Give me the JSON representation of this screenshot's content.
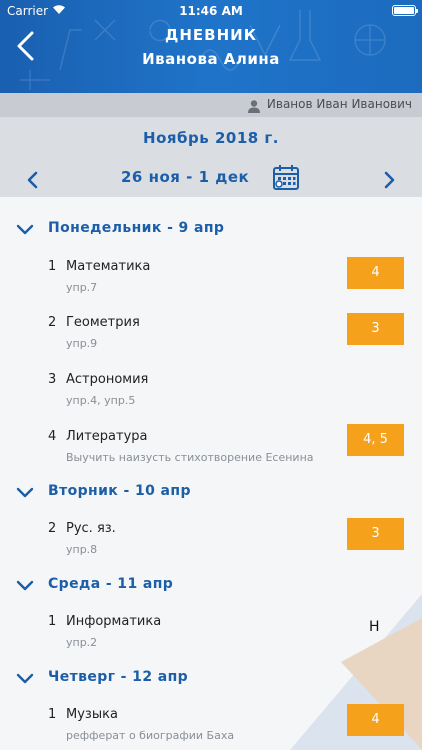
{
  "status": {
    "carrier": "Carrier",
    "time": "11:46 AM"
  },
  "header": {
    "title": "ДНЕВНИК",
    "subtitle": "Иванова Алина"
  },
  "user": {
    "name": "Иванов Иван Иванович"
  },
  "period": {
    "month": "Ноябрь 2018 г.",
    "week": "26 ноя - 1 дек"
  },
  "colors": {
    "primary": "#1d5ea8",
    "grade_bg": "#f5a11b",
    "header_bg": "#1c6bbf"
  },
  "days": [
    {
      "label": "Понедельник - 9 апр",
      "lessons": [
        {
          "num": "1",
          "subject": "Математика",
          "homework": "упр.7",
          "grade": "4"
        },
        {
          "num": "2",
          "subject": "Геометрия",
          "homework": "упр.9",
          "grade": "3"
        },
        {
          "num": "3",
          "subject": "Астрономия",
          "homework": "упр.4, упр.5",
          "grade": ""
        },
        {
          "num": "4",
          "subject": "Литература",
          "homework": "Выучить наизусть стихотворение Есенина",
          "grade": "4, 5"
        }
      ]
    },
    {
      "label": "Вторник - 10 апр",
      "lessons": [
        {
          "num": "2",
          "subject": "Рус. яз.",
          "homework": "упр.8",
          "grade": "3"
        }
      ]
    },
    {
      "label": "Среда - 11 апр",
      "lessons": [
        {
          "num": "1",
          "subject": "Информатика",
          "homework": "упр.2",
          "grade": "Н"
        }
      ]
    },
    {
      "label": "Четверг - 12 апр",
      "lessons": [
        {
          "num": "1",
          "subject": "Музыка",
          "homework": "рефферат о биографии Баха",
          "grade": "4"
        }
      ]
    }
  ]
}
